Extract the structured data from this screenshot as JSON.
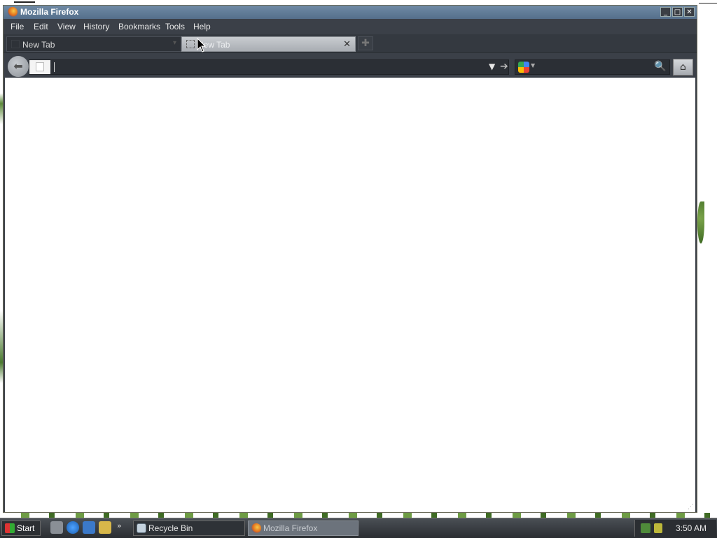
{
  "window": {
    "title": "Mozilla Firefox",
    "controls": {
      "minimize": "_",
      "maximize": "□",
      "close": "✕"
    }
  },
  "menubar": {
    "items": [
      "File",
      "Edit",
      "View",
      "History",
      "Bookmarks",
      "Tools",
      "Help"
    ]
  },
  "tabs": [
    {
      "label": "New Tab",
      "active": false
    },
    {
      "label": "New Tab",
      "active": true
    }
  ],
  "navbar": {
    "url_value": "",
    "search_value": "",
    "search_engine_icon": "google-icon"
  },
  "taskbar": {
    "start_label": "Start",
    "buttons": [
      {
        "label": "Recycle Bin",
        "icon": "recycle-bin-icon"
      },
      {
        "label": "Mozilla Firefox",
        "icon": "firefox-icon",
        "active": true
      }
    ],
    "clock": "3:50 AM"
  },
  "colors": {
    "titlebar": "#6f8aa5",
    "chrome": "#3b4048",
    "taskbar": "#2a2d31"
  }
}
